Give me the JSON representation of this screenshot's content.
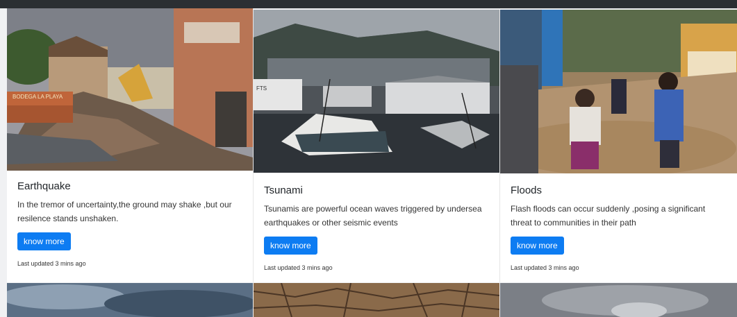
{
  "cards": [
    {
      "title": "Earthquake",
      "text": "In the tremor of uncertainty,the ground may shake ,but our resilence stands unshaken.",
      "button": "know more",
      "updated": "Last updated 3 mins ago",
      "image_sign": "BODEGA LA PLAYA"
    },
    {
      "title": "Tsunami",
      "text": "Tsunamis are powerful ocean waves triggered by undersea earthquakes or other seismic events",
      "button": "know more",
      "updated": "Last updated 3 mins ago",
      "image_sign": "FTS"
    },
    {
      "title": "Floods",
      "text": "Flash floods can occur suddenly ,posing a significant threat to communities in their path",
      "button": "know more",
      "updated": "Last updated 3 mins ago",
      "image_sign": ""
    }
  ],
  "colors": {
    "accent": "#0d7cf2",
    "topbar": "#2b2f33",
    "card_bg": "#ffffff",
    "page_bg": "#f0f1f3"
  }
}
